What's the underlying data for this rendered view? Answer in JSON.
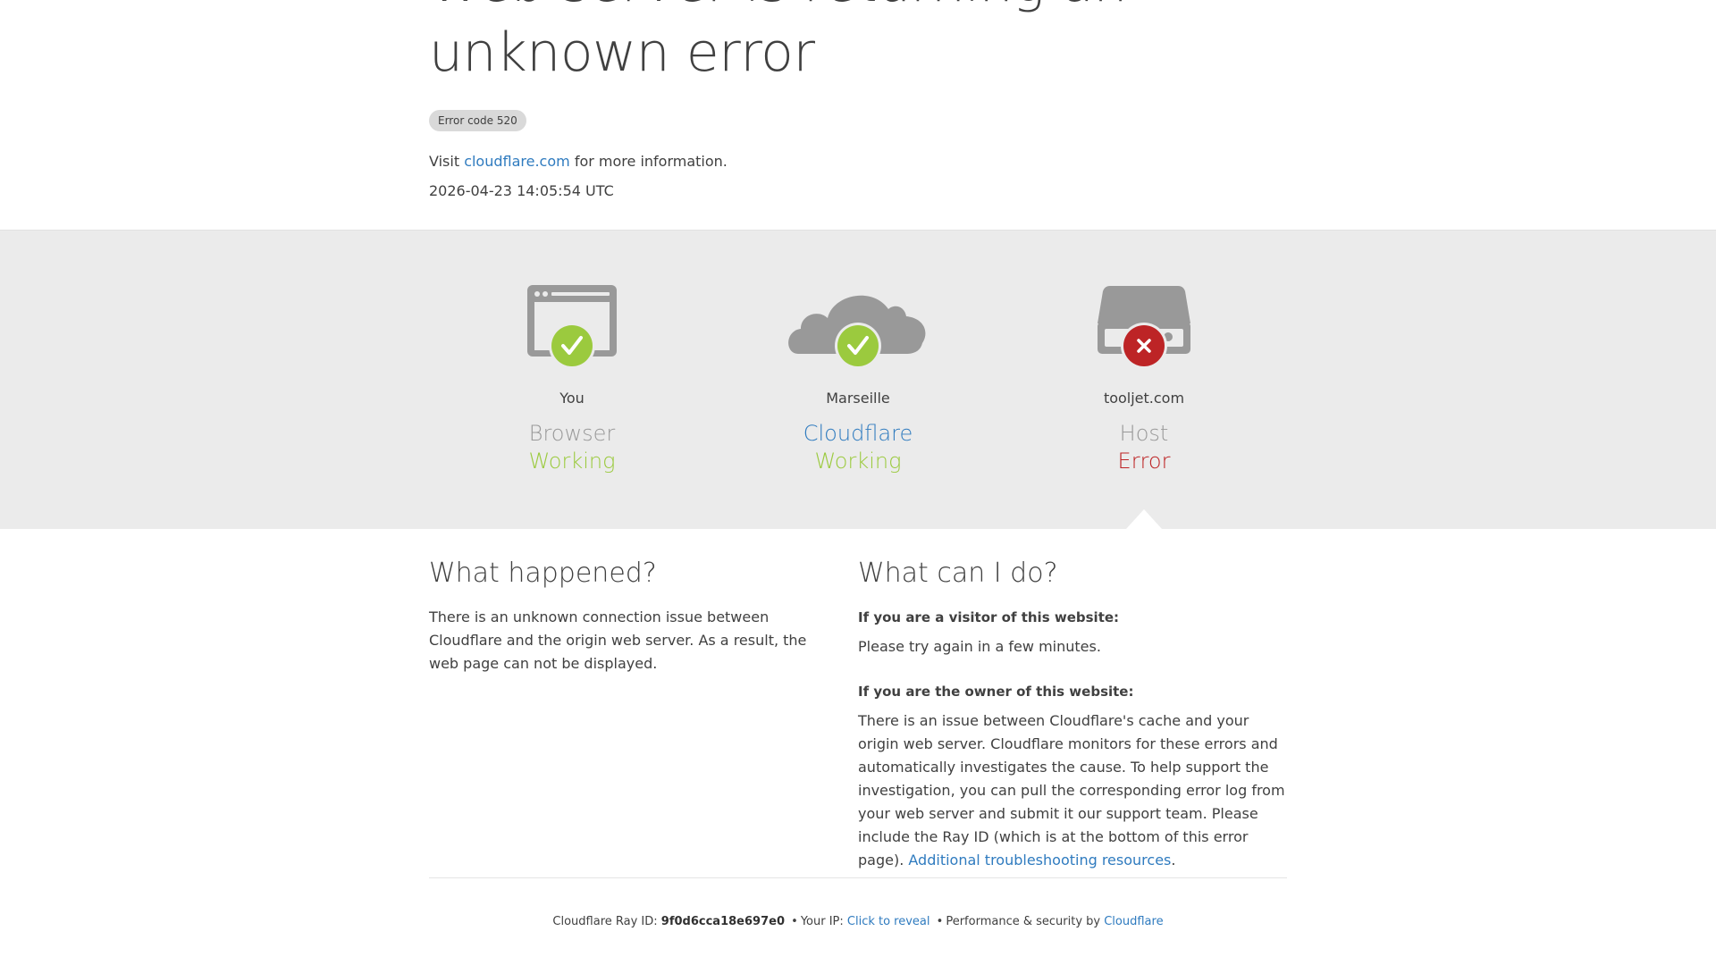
{
  "header": {
    "title_line1": "Web server is returning an",
    "title_line2": "unknown error",
    "error_code": "Error code 520",
    "visit_prefix": "Visit",
    "visit_link": "cloudflare.com",
    "visit_suffix": "for more information.",
    "timestamp": "2026-04-23 14:05:54 UTC"
  },
  "status": {
    "browser": {
      "place": "You",
      "kind": "Browser",
      "state": "Working",
      "icon": "browser-icon",
      "badge": "check-icon"
    },
    "cloudflare": {
      "place": "Marseille",
      "kind": "Cloudflare",
      "state": "Working",
      "icon": "cloud-icon",
      "badge": "check-icon"
    },
    "host": {
      "place": "tooljet.com",
      "kind": "Host",
      "state": "Error",
      "icon": "server-icon",
      "badge": "close-icon"
    }
  },
  "colors": {
    "ok": "#9bca3e",
    "error": "#bd2426",
    "link": "#2f7bbf",
    "icon_gray": "#999999",
    "band": "#ebebeb"
  },
  "what_happened": {
    "heading": "What happened?",
    "text": "There is an unknown connection issue between Cloudflare and the origin web server. As a result, the web page can not be displayed."
  },
  "what_can_i_do": {
    "heading": "What can I do?",
    "visitor_heading": "If you are a visitor of this website:",
    "visitor_text": "Please try again in a few minutes.",
    "owner_heading": "If you are the owner of this website:",
    "owner_text": "There is an issue between Cloudflare's cache and your origin web server. Cloudflare monitors for these errors and automatically investigates the cause. To help support the investigation, you can pull the corresponding error log from your web server and submit it our support team. Please include the Ray ID (which is at the bottom of this error page).",
    "owner_link": "Additional troubleshooting resources",
    "owner_link_suffix": "."
  },
  "footer": {
    "ray_label": "Cloudflare Ray ID:",
    "ray_id": "9f0d6cca18e697e0",
    "bullet": "•",
    "ip_label": "Your IP:",
    "ip_link": "Click to reveal",
    "perf_label": "Performance & security by",
    "perf_link": "Cloudflare"
  }
}
